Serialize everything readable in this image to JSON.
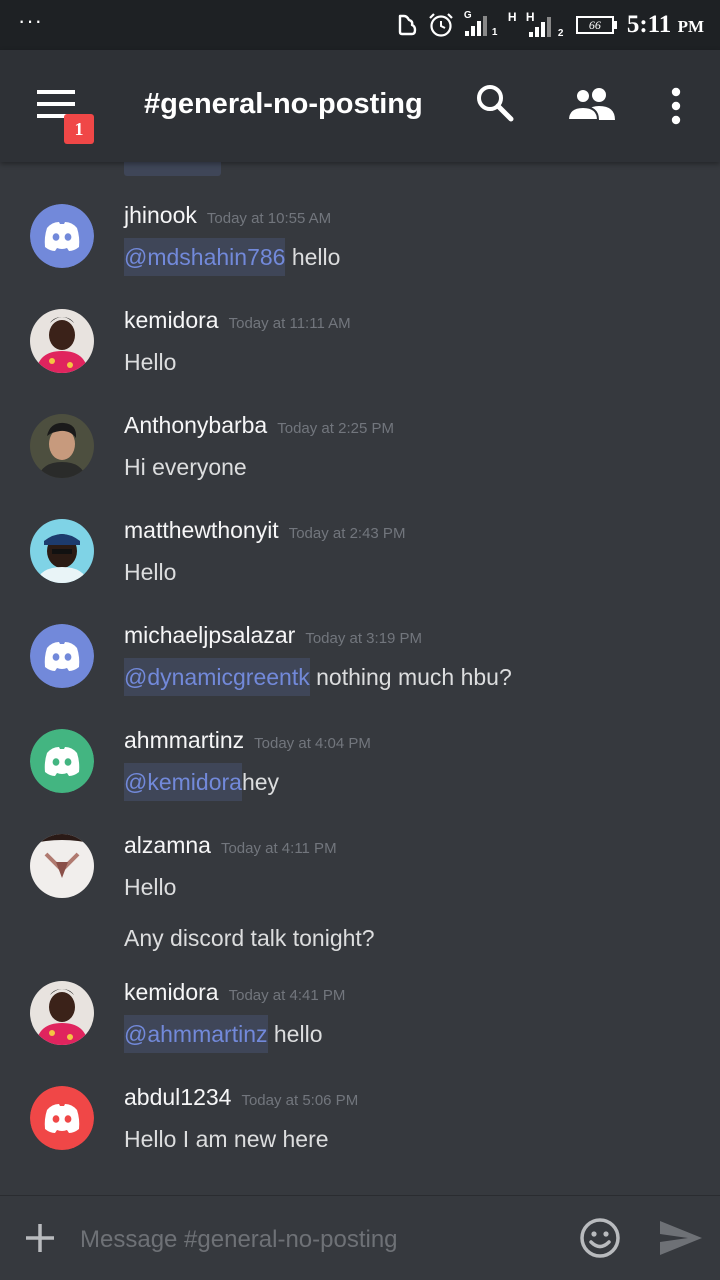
{
  "status_bar": {
    "menu_dots": "···",
    "sim1_label": "G",
    "sim1_slot": "1",
    "sim2_label": "H",
    "sim2_label_b": "H",
    "sim2_slot": "2",
    "battery": "66",
    "time": "5:11",
    "ampm": "PM"
  },
  "toolbar": {
    "notification_count": "1",
    "channel_name": "#general-no-posting"
  },
  "messages": [
    {
      "author": "jhinook",
      "timestamp": "Today at 10:55 AM",
      "mention": "@mdshahin786",
      "text": " hello",
      "avatar": "discord-default-blurple"
    },
    {
      "author": "kemidora",
      "timestamp": "Today at 11:11 AM",
      "mention": "",
      "text": "Hello",
      "avatar": "photo"
    },
    {
      "author": "Anthonybarba",
      "timestamp": "Today at 2:25 PM",
      "mention": "",
      "text": "Hi everyone",
      "avatar": "photo"
    },
    {
      "author": "matthewthonyit",
      "timestamp": "Today at 2:43 PM",
      "mention": "",
      "text": "Hello",
      "avatar": "photo"
    },
    {
      "author": "michaeljpsalazar",
      "timestamp": "Today at 3:19 PM",
      "mention": "@dynamicgreentk",
      "text": " nothing much hbu?",
      "avatar": "discord-default-blurple"
    },
    {
      "author": "ahmmartinz",
      "timestamp": "Today at 4:04 PM",
      "mention": "@kemidora",
      "text": "hey",
      "avatar": "discord-default-green"
    },
    {
      "author": "alzamna",
      "timestamp": "Today at 4:11 PM",
      "mention": "",
      "text": "Hello",
      "extra": "Any discord talk tonight?",
      "avatar": "photo"
    },
    {
      "author": "kemidora",
      "timestamp": "Today at 4:41 PM",
      "mention": "@ahmmartinz",
      "text": " hello",
      "avatar": "photo"
    },
    {
      "author": "abdul1234",
      "timestamp": "Today at 5:06 PM",
      "mention": "",
      "text": "Hello I am new here",
      "avatar": "discord-default-red"
    }
  ],
  "composer": {
    "placeholder": "Message #general-no-posting"
  },
  "colors": {
    "background": "#36393e",
    "toolbar": "#2e3136",
    "status_bar": "#1e2124",
    "mention_text": "#7289da",
    "mention_bg": "#3f4658",
    "blurple": "#7289da",
    "green": "#43b581",
    "red": "#f04747",
    "badge": "#f04747"
  }
}
